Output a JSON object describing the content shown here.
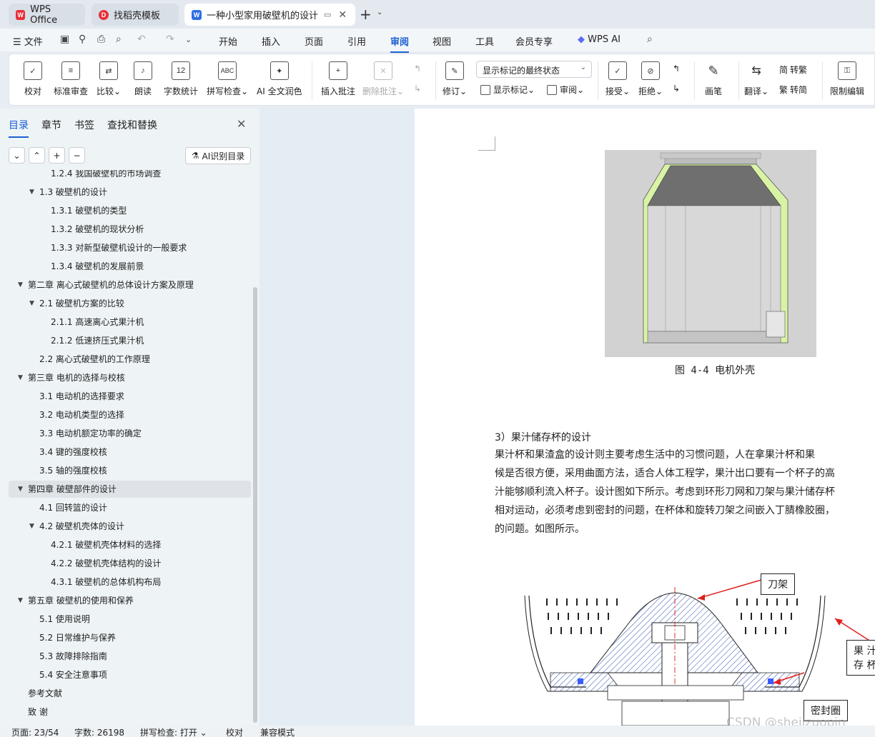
{
  "tabs": [
    {
      "label": "WPS Office",
      "icon": "wps-logo-icon"
    },
    {
      "label": "找稻壳模板",
      "icon": "docer-logo-icon"
    },
    {
      "label": "一种小型家用破壁机的设计 说",
      "icon": "word-doc-icon",
      "active": true
    }
  ],
  "menu": {
    "file": "文件",
    "items": [
      "开始",
      "插入",
      "页面",
      "引用",
      "审阅",
      "视图",
      "工具",
      "会员专享",
      "WPS AI"
    ],
    "active": "审阅"
  },
  "ribbon": {
    "proofread": "校对",
    "standard_review": "标准审查",
    "compare": "比较",
    "read_aloud": "朗读",
    "word_count": "字数统计",
    "spell_check": "拼写检查",
    "ai_polish": "AI 全文润色",
    "insert_comment": "插入批注",
    "delete_comment": "删除批注",
    "track_changes": "修订",
    "display_state": "显示标记的最终状态",
    "show_markup": "显示标记",
    "review_pane": "审阅",
    "accept": "接受",
    "reject": "拒绝",
    "pen": "画笔",
    "translate": "翻译",
    "to_traditional": "转繁",
    "to_simplified": "转简",
    "restrict_editing": "限制编辑",
    "icons": {
      "word_count_badge": "12",
      "spell_badge": "ABC",
      "trad_char": "简",
      "simp_char": "繁"
    }
  },
  "nav": {
    "tabs": [
      "目录",
      "章节",
      "书签",
      "查找和替换"
    ],
    "active_tab": "目录",
    "ai_toc_button": "AI识别目录",
    "toc": [
      {
        "text": "1.2.4 我国破壁机的市场调查",
        "level": 3
      },
      {
        "text": "1.3  破壁机的设计",
        "level": 2,
        "expanded": true
      },
      {
        "text": "1.3.1 破壁机的类型",
        "level": 3
      },
      {
        "text": "1.3.2  破壁机的现状分析",
        "level": 3
      },
      {
        "text": "1.3.3 对新型破壁机设计的一般要求",
        "level": 3
      },
      {
        "text": "1.3.4  破壁机的发展前景",
        "level": 3
      },
      {
        "text": "第二章  离心式破壁机的总体设计方案及原理",
        "level": 1,
        "expanded": true
      },
      {
        "text": "2.1  破壁机方案的比较",
        "level": 2,
        "expanded": true
      },
      {
        "text": "2.1.1 高速离心式果汁机",
        "level": 3
      },
      {
        "text": "2.1.2  低速挤压式果汁机",
        "level": 3
      },
      {
        "text": "2.2 离心式破壁机的工作原理",
        "level": 2
      },
      {
        "text": "第三章  电机的选择与校核",
        "level": 1,
        "expanded": true
      },
      {
        "text": "3.1  电动机的选择要求",
        "level": 2
      },
      {
        "text": "3.2  电动机类型的选择",
        "level": 2
      },
      {
        "text": "3.3  电动机额定功率的确定",
        "level": 2
      },
      {
        "text": "3.4  键的强度校核",
        "level": 2
      },
      {
        "text": "3.5  轴的强度校核",
        "level": 2
      },
      {
        "text": "第四章     破壁部件的设计",
        "level": 1,
        "expanded": true,
        "selected": true
      },
      {
        "text": "4.1  回转篮的设计",
        "level": 2
      },
      {
        "text": "4.2 破壁机壳体的设计",
        "level": 2,
        "expanded": true
      },
      {
        "text": "4.2.1  破壁机壳体材料的选择",
        "level": 3
      },
      {
        "text": "4.2.2 破壁机壳体结构的设计",
        "level": 3
      },
      {
        "text": "4.3.1 破壁机的总体机构布局",
        "level": 3
      },
      {
        "text": "第五章     破壁机的使用和保养",
        "level": 1,
        "expanded": true
      },
      {
        "text": "5.1  使用说明",
        "level": 2
      },
      {
        "text": "5.2  日常维护与保养",
        "level": 2
      },
      {
        "text": "5.3  故障排除指南",
        "level": 2
      },
      {
        "text": "5.4  安全注意事项",
        "level": 2
      },
      {
        "text": "参考文献",
        "level": 1
      },
      {
        "text": "致      谢",
        "level": 1
      }
    ]
  },
  "document": {
    "fig1_caption": "图 4-4  电机外壳",
    "section_heading": "3）果汁储存杯的设计",
    "paragraph_lines": [
      "    果汁杯和果渣盒的设计则主要考虑生活中的习惯问题，人在拿果汁杯和果",
      "候是否很方便，采用曲面方法，适合人体工程学，果汁出口要有一个杯子的高",
      "汁能够顺利流入杯子。设计图如下所示。考虑到环形刀网和刀架与果汁储存杯",
      "相对运动，必须考虑到密封的问题，在杯体和旋转刀架之间嵌入丁腈橡胶圈，",
      "的问题。如图所示。"
    ],
    "callouts": {
      "blade_holder": "刀架",
      "juice_cup_line1": "果 汁",
      "juice_cup_line2": "存 杯",
      "seal_ring": "密封圈"
    },
    "watermark": "CSDN @shejizuopin"
  },
  "status": {
    "page": "页面: 23/54",
    "words": "字数: 26198",
    "spell": "拼写检查: 打开",
    "proof": "校对",
    "compat": "兼容模式"
  },
  "colors": {
    "accent": "#1a5fd0",
    "figure_green": "#d8f0a0",
    "callout_arrow": "#e0201e",
    "hatch": "#3050b0"
  }
}
